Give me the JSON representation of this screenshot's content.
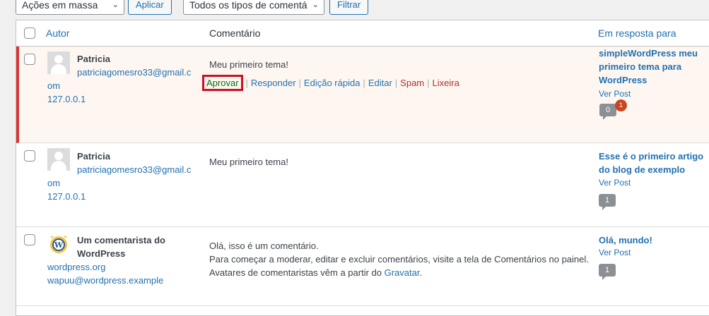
{
  "toolbar": {
    "bulk_actions": "Ações em massa",
    "apply": "Aplicar",
    "comment_type": "Todos os tipos de comentá",
    "filter": "Filtrar"
  },
  "columns": {
    "author": "Autor",
    "comment": "Comentário",
    "in_response_to": "Em resposta para"
  },
  "rows": [
    {
      "author_name": "Patricia",
      "email_line1": "patriciagomesro33@gmail.c",
      "email_line2": "om",
      "ip": "127.0.0.1",
      "comment": "Meu primeiro tema!",
      "actions": {
        "approve": "Aprovar",
        "reply": "Responder",
        "quick_edit": "Edição rápida",
        "edit": "Editar",
        "spam": "Spam",
        "trash": "Lixeira"
      },
      "post_title_line1": "simpleWordPress meu",
      "post_title_line2": "primeiro tema para",
      "post_title_line3": "WordPress",
      "view_post": "Ver Post",
      "approved_count": "0",
      "pending_count": "1"
    },
    {
      "author_name": "Patricia",
      "email_line1": "patriciagomesro33@gmail.c",
      "email_line2": "om",
      "ip": "127.0.0.1",
      "comment": "Meu primeiro tema!",
      "post_title_line1": "Esse é o primeiro artigo",
      "post_title_line2": "do blog de exemplo",
      "view_post": "Ver Post",
      "approved_count": "1"
    },
    {
      "author_name_line1": "Um comentarista do",
      "author_name_line2": "WordPress",
      "url": "wordpress.org",
      "email": "wapuu@wordpress.example",
      "comment_line1": "Olá, isso é um comentário.",
      "comment_line2": "Para começar a moderar, editar e excluir comentários, visite a tela de Comentários no painel.",
      "comment_line3_prefix": "Avatares de comentaristas vêm a partir do ",
      "comment_line3_link": "Gravatar",
      "comment_line3_suffix": ".",
      "post_title": "Olá, mundo!",
      "view_post": "Ver Post",
      "approved_count": "1"
    }
  ],
  "colors": {
    "link": "#2271b1",
    "unapproved_border": "#d63638",
    "highlight_box": "#d10d1f",
    "approve_green": "#007017",
    "danger_red": "#b32d2e"
  }
}
